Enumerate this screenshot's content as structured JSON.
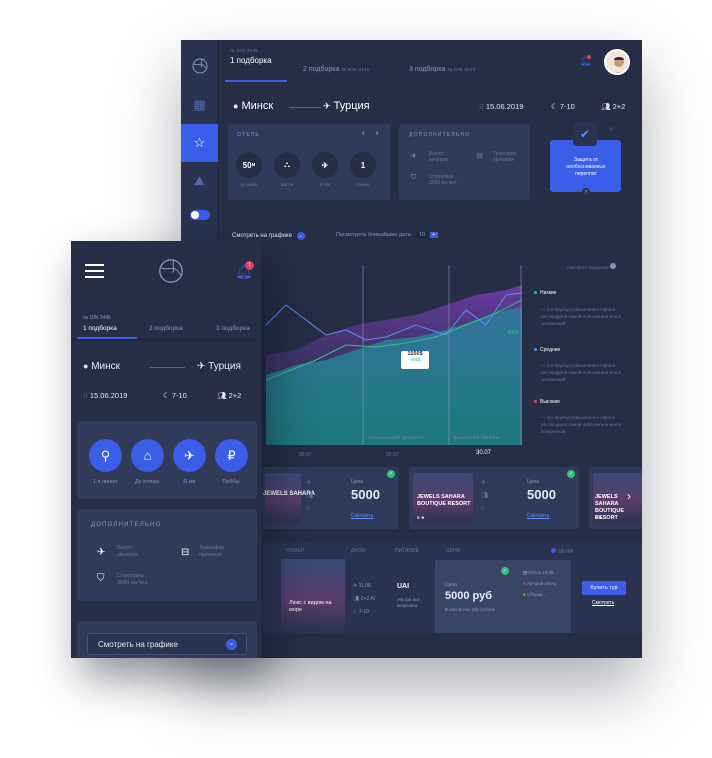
{
  "desktop": {
    "tabs": [
      {
        "sub": "№ DIN 3445",
        "label": "1 подборка"
      },
      {
        "label": "2 подборка",
        "sub": "№ DIN 3445"
      },
      {
        "label": "3 подборка",
        "sub": "№ DIN 3445"
      }
    ],
    "route": {
      "from": "Минск",
      "to": "Турция",
      "date": "15.06.2019",
      "nights": "7-10",
      "people": "2+2"
    },
    "hotel_card": {
      "caption": "ОТЕЛЬ",
      "items": [
        {
          "value": "50",
          "label": "до моря"
        },
        {
          "value": "",
          "label": "Бассе"
        },
        {
          "value": "",
          "label": "5 KM"
        },
        {
          "value": "1",
          "label": "Линия"
        }
      ]
    },
    "extra_card": {
      "caption": "ДОПОЛНИТЕЛЬНО",
      "items": [
        {
          "label": "Вылет\nвечером"
        },
        {
          "label": "Трансфер\nпремиум"
        },
        {
          "label": "Страховка\n3000 на чел"
        }
      ]
    },
    "protection": {
      "text": "Защита от необоснованных переплат"
    },
    "controls": {
      "schedule": "Смотреть на графике",
      "nearest": "Посмотреть ближайшие даты",
      "toggle_value": "10"
    },
    "chart_tooltip": {
      "value": "1550$",
      "delta": "-400$"
    },
    "chart_tooltip2": {
      "value": "1550$",
      "delta": "-400$"
    },
    "chart_label_left": "-400$",
    "chart_label_mid": "-400$",
    "chart_section_labels": [
      "низкий сезон",
      "начальный доступ",
      "высокий сезон"
    ],
    "chart_dates": [
      "20.07",
      "25.07",
      "30.07"
    ],
    "chart_hint": "Смотреть подсказку",
    "legend": [
      {
        "title": "Низкие",
        "desc": "— это период повышенного спроса на поездки в самой либо регион или в конкретный",
        "color": "#2ec27e"
      },
      {
        "title": "Средние",
        "desc": "— это период повышенного спроса на поездки в самой либо регион или в конкретный",
        "color": "#5a8cff"
      },
      {
        "title": "Высокие",
        "desc": "— это период повышенного спроса на поездки в самой либо регион или в конкретный",
        "color": "#e0405a"
      }
    ],
    "hotel_results": [
      {
        "name": "JEWELS SAHARA",
        "price_label": "Цена",
        "price": "5000",
        "link": "Смотреть"
      },
      {
        "name": "JEWELS SAHARA BOUTIQUE RESORT",
        "rating": "5 ★",
        "price_label": "Цена",
        "price": "5000",
        "link": "Смотреть"
      },
      {
        "name": "JEWELS SAHARA BOUTIQUE RESORT",
        "rating": "5 ★"
      }
    ],
    "table": {
      "headers": [
        "НОМЕР",
        "ДАТЫ",
        "ПИТАНИЕ",
        "ЦЕНА",
        "МЕНЯ"
      ],
      "room": "Люкс с видом на море",
      "dates": [
        "11.06",
        "2+2 AI",
        "7-10"
      ],
      "meal": "UAI",
      "meal_desc": "Ультра все включено",
      "price_label": "Цена",
      "price": "5000 руб",
      "installment": "В рассрочку 250 рублей",
      "options": [
        "Отель 10.06",
        "Лучший отель",
        "Сборка..."
      ],
      "buy": "Купить тур",
      "view": "Смотреть"
    }
  },
  "mobile": {
    "tabs_sub": "№ DIN 3445",
    "tabs": [
      "1 подборка",
      "2 подборка",
      "3 подборка"
    ],
    "route": {
      "from": "Минск",
      "to": "Турция",
      "date": "15.06.2019",
      "nights": "7-10",
      "people": "2+2"
    },
    "notif_count": "1",
    "features": [
      {
        "label": "1 я линия"
      },
      {
        "label": "До пляжа"
      },
      {
        "label": "Я км"
      },
      {
        "label": "Поббы"
      }
    ],
    "extra": {
      "caption": "ДОПОЛНИТЕЛЬНО",
      "items": [
        {
          "label": "Вылет\nзвонком"
        },
        {
          "label": "Трансфер\nпремиум"
        },
        {
          "label": "Страховка\n3000 на чел"
        }
      ]
    },
    "schedule_button": "Смотреть на графике"
  }
}
